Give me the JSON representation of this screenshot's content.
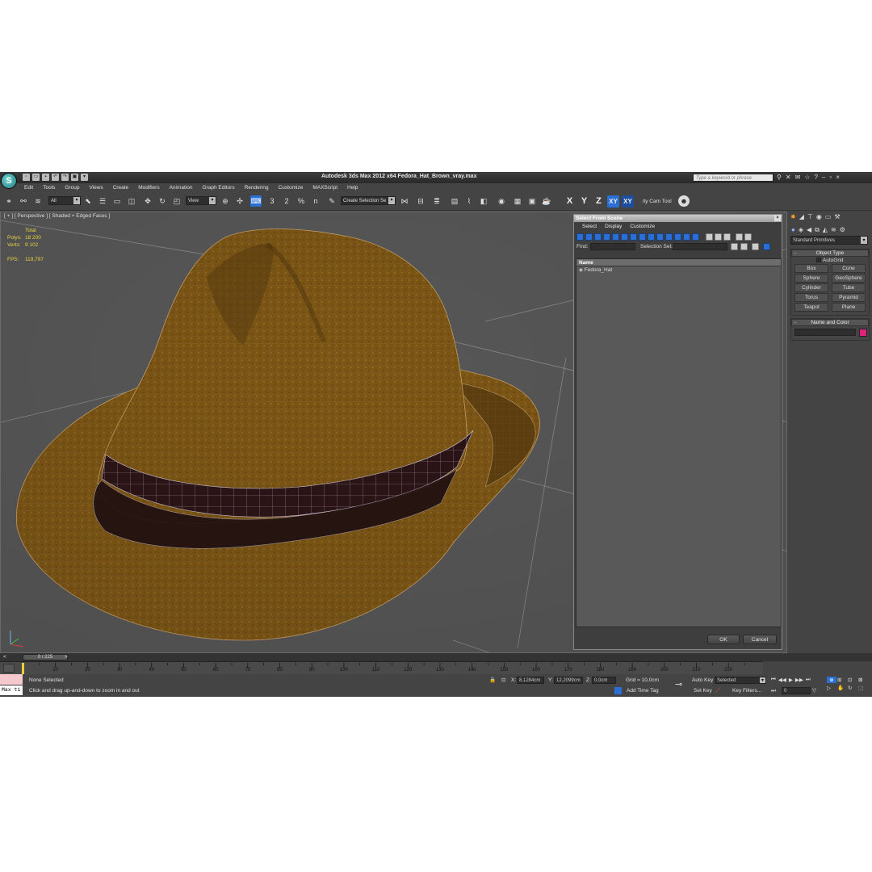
{
  "window": {
    "title": "Autodesk 3ds Max  2012 x64    Fedora_Hat_Brown_vray.max",
    "search_placeholder": "Type a keyword or phrase"
  },
  "menus": [
    "Edit",
    "Tools",
    "Group",
    "Views",
    "Create",
    "Modifiers",
    "Animation",
    "Graph Editors",
    "Rendering",
    "Customize",
    "MAXScript",
    "Help"
  ],
  "toolbar": {
    "filter_value": "All",
    "ref_coord_value": "View",
    "selection_set_value": "Create Selection Se",
    "axis_x": "X",
    "axis_y": "Y",
    "axis_z": "Z",
    "axis_xy": "XY",
    "axis_xy2": "XY",
    "cam_tool": "ity Cam Tool",
    "snap_3": "3",
    "snap_2": "2",
    "snap_pct": "%",
    "snap_n": "n"
  },
  "viewport": {
    "label": "[ + ] [ Perspective ] [ Shaded + Edged Faces ]",
    "stats_header": "Total",
    "polys_label": "Polys:",
    "polys_value": "18 200",
    "verts_label": "Verts:",
    "verts_value": "9 102",
    "fps_label": "FPS:",
    "fps_value": "119,797"
  },
  "select_from_scene": {
    "title": "Select From Scene",
    "menu": [
      "Select",
      "Display",
      "Customize"
    ],
    "find_label": "Find:",
    "selection_set_label": "Selection Set:",
    "column_name": "Name",
    "items": [
      "Fedora_Hat"
    ],
    "ok": "OK",
    "cancel": "Cancel"
  },
  "command_panel": {
    "category_dropdown": "Standard Primitives",
    "object_type_header": "Object Type",
    "autogrid": "AutoGrid",
    "primitives": [
      "Box",
      "Cone",
      "Sphere",
      "GeoSphere",
      "Cylinder",
      "Tube",
      "Torus",
      "Pyramid",
      "Teapot",
      "Plane"
    ],
    "name_color_header": "Name and Color",
    "object_color": "#e0227a"
  },
  "timeline": {
    "frame_counter": "0 / 225",
    "ticks": [
      "10",
      "20",
      "30",
      "40",
      "50",
      "60",
      "70",
      "80",
      "90",
      "100",
      "110",
      "120",
      "130",
      "140",
      "150",
      "160",
      "170",
      "180",
      "190",
      "200",
      "210",
      "220"
    ]
  },
  "status": {
    "maxscript": "Max ti",
    "selection": "None Selected",
    "prompt": "Click and drag up-and-down to zoom in and out",
    "x_label": "X:",
    "x_value": "8,1284cm",
    "y_label": "Y:",
    "y_value": "12,2099cm",
    "z_label": "Z:",
    "z_value": "0,0cm",
    "grid": "Grid = 10,0cm",
    "add_time_tag": "Add Time Tag",
    "auto_key": "Auto Key",
    "selected_dropdown": "Selected",
    "set_key": "Set Key",
    "key_filters": "Key Filters...",
    "frame_field": "0"
  },
  "colors": {
    "accent": "#2a6fd6",
    "viewport_bg": "#575757",
    "stats_text": "#e8d23c",
    "hat_felt": "#7a5414",
    "hat_band": "#2a1416"
  }
}
